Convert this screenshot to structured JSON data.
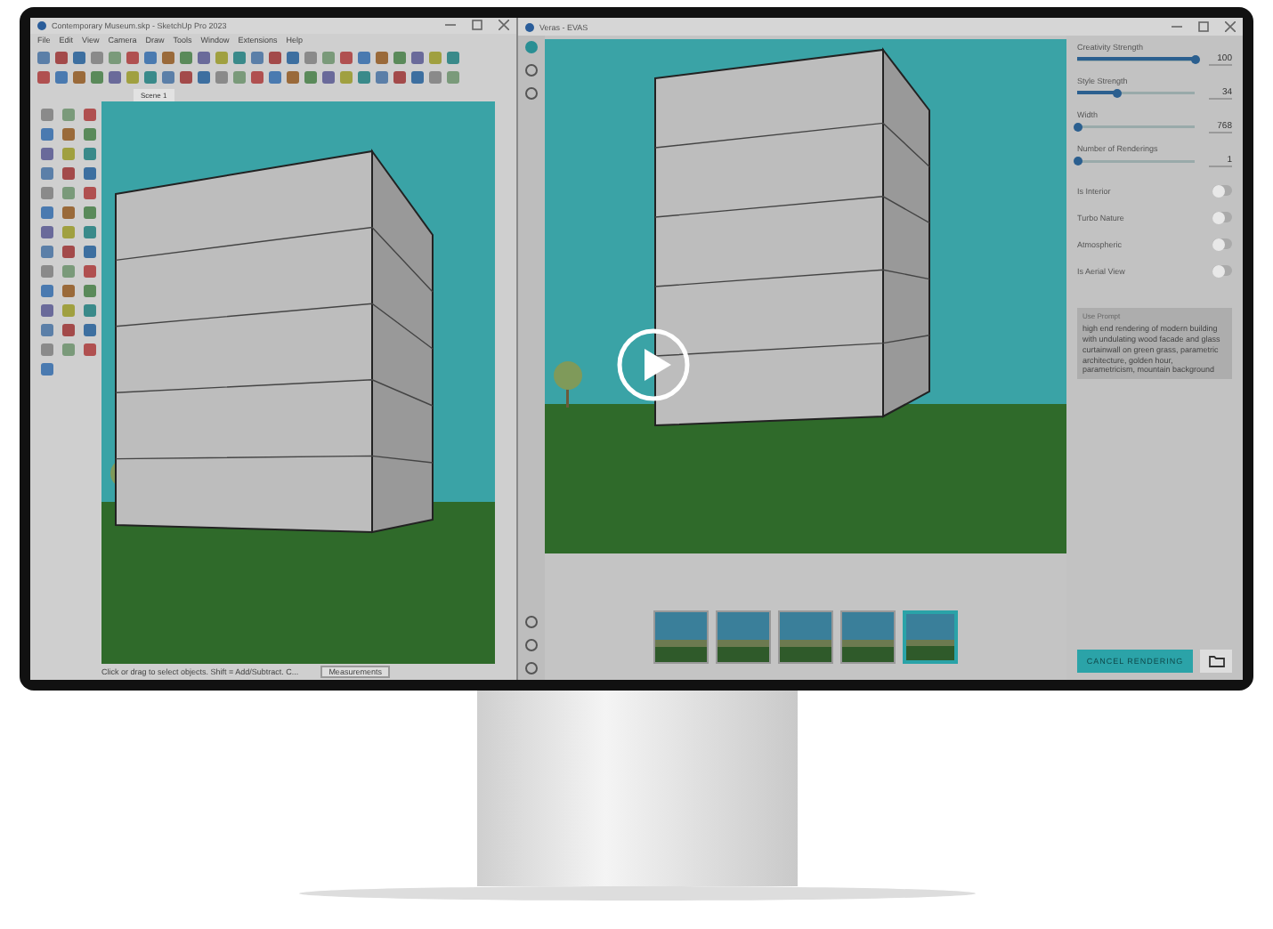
{
  "sketchup": {
    "title": "Contemporary Museum.skp - SketchUp Pro 2023",
    "menu": [
      "File",
      "Edit",
      "View",
      "Camera",
      "Draw",
      "Tools",
      "Window",
      "Extensions",
      "Help"
    ],
    "scene_tab": "Scene 1",
    "status": "Click or drag to select objects. Shift = Add/Subtract. C...",
    "measurements": "Measurements"
  },
  "veras": {
    "title": "Veras - EVAS",
    "sliders": [
      {
        "label": "Creativity Strength",
        "value": "100",
        "level": 1
      },
      {
        "label": "Style Strength",
        "value": "34",
        "level": 0.34
      },
      {
        "label": "Width",
        "value": "768",
        "level": 0
      },
      {
        "label": "Number of Renderings",
        "value": "1",
        "level": 0
      }
    ],
    "toggles": [
      {
        "label": "Is Interior",
        "on": false
      },
      {
        "label": "Turbo Nature",
        "on": false
      },
      {
        "label": "Atmospheric",
        "on": false
      },
      {
        "label": "Is Aerial View",
        "on": false
      }
    ],
    "prompt_label": "Use Prompt",
    "prompt": "high end rendering of modern building with undulating wood facade and glass curtainwall on green grass, parametric architecture, golden hour, parametricism, mountain background",
    "cancel_button": "CANCEL RENDERING",
    "thumbnails": [
      {
        "selected": false
      },
      {
        "selected": false
      },
      {
        "selected": false
      },
      {
        "selected": false
      },
      {
        "selected": true
      }
    ]
  }
}
